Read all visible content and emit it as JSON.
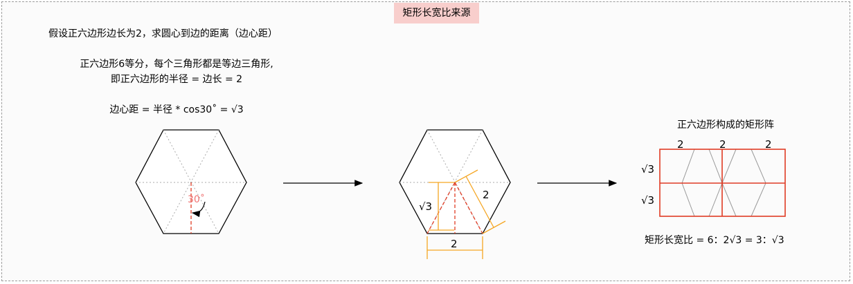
{
  "title": "矩形长宽比来源",
  "intro": {
    "line1": "假设正六边形边长为2，求圆心到边的距离（边心距）",
    "line2": "正六边形6等分，每个三角形都是等边三角形,",
    "line3": "即正六边形的半径 = 边长 = 2",
    "line4": "边心距 = 半径 * cos30˚ = √3"
  },
  "hexagon1": {
    "angle_label": "30˚"
  },
  "hexagon2": {
    "height_label": "√3",
    "side_label": "2",
    "bottom_label": "2"
  },
  "rect_array": {
    "title": "正六边形构成的矩形阵",
    "col_labels": [
      "2",
      "2",
      "2"
    ],
    "row_labels": [
      "√3",
      "√3"
    ],
    "ratio": "矩形长宽比 = 6：2√3 = 3：√3"
  },
  "colors": {
    "title_bg": "#f8cecc",
    "red": "#e03b24",
    "orange": "#f5a623",
    "dashed_red": "#e03b24"
  }
}
